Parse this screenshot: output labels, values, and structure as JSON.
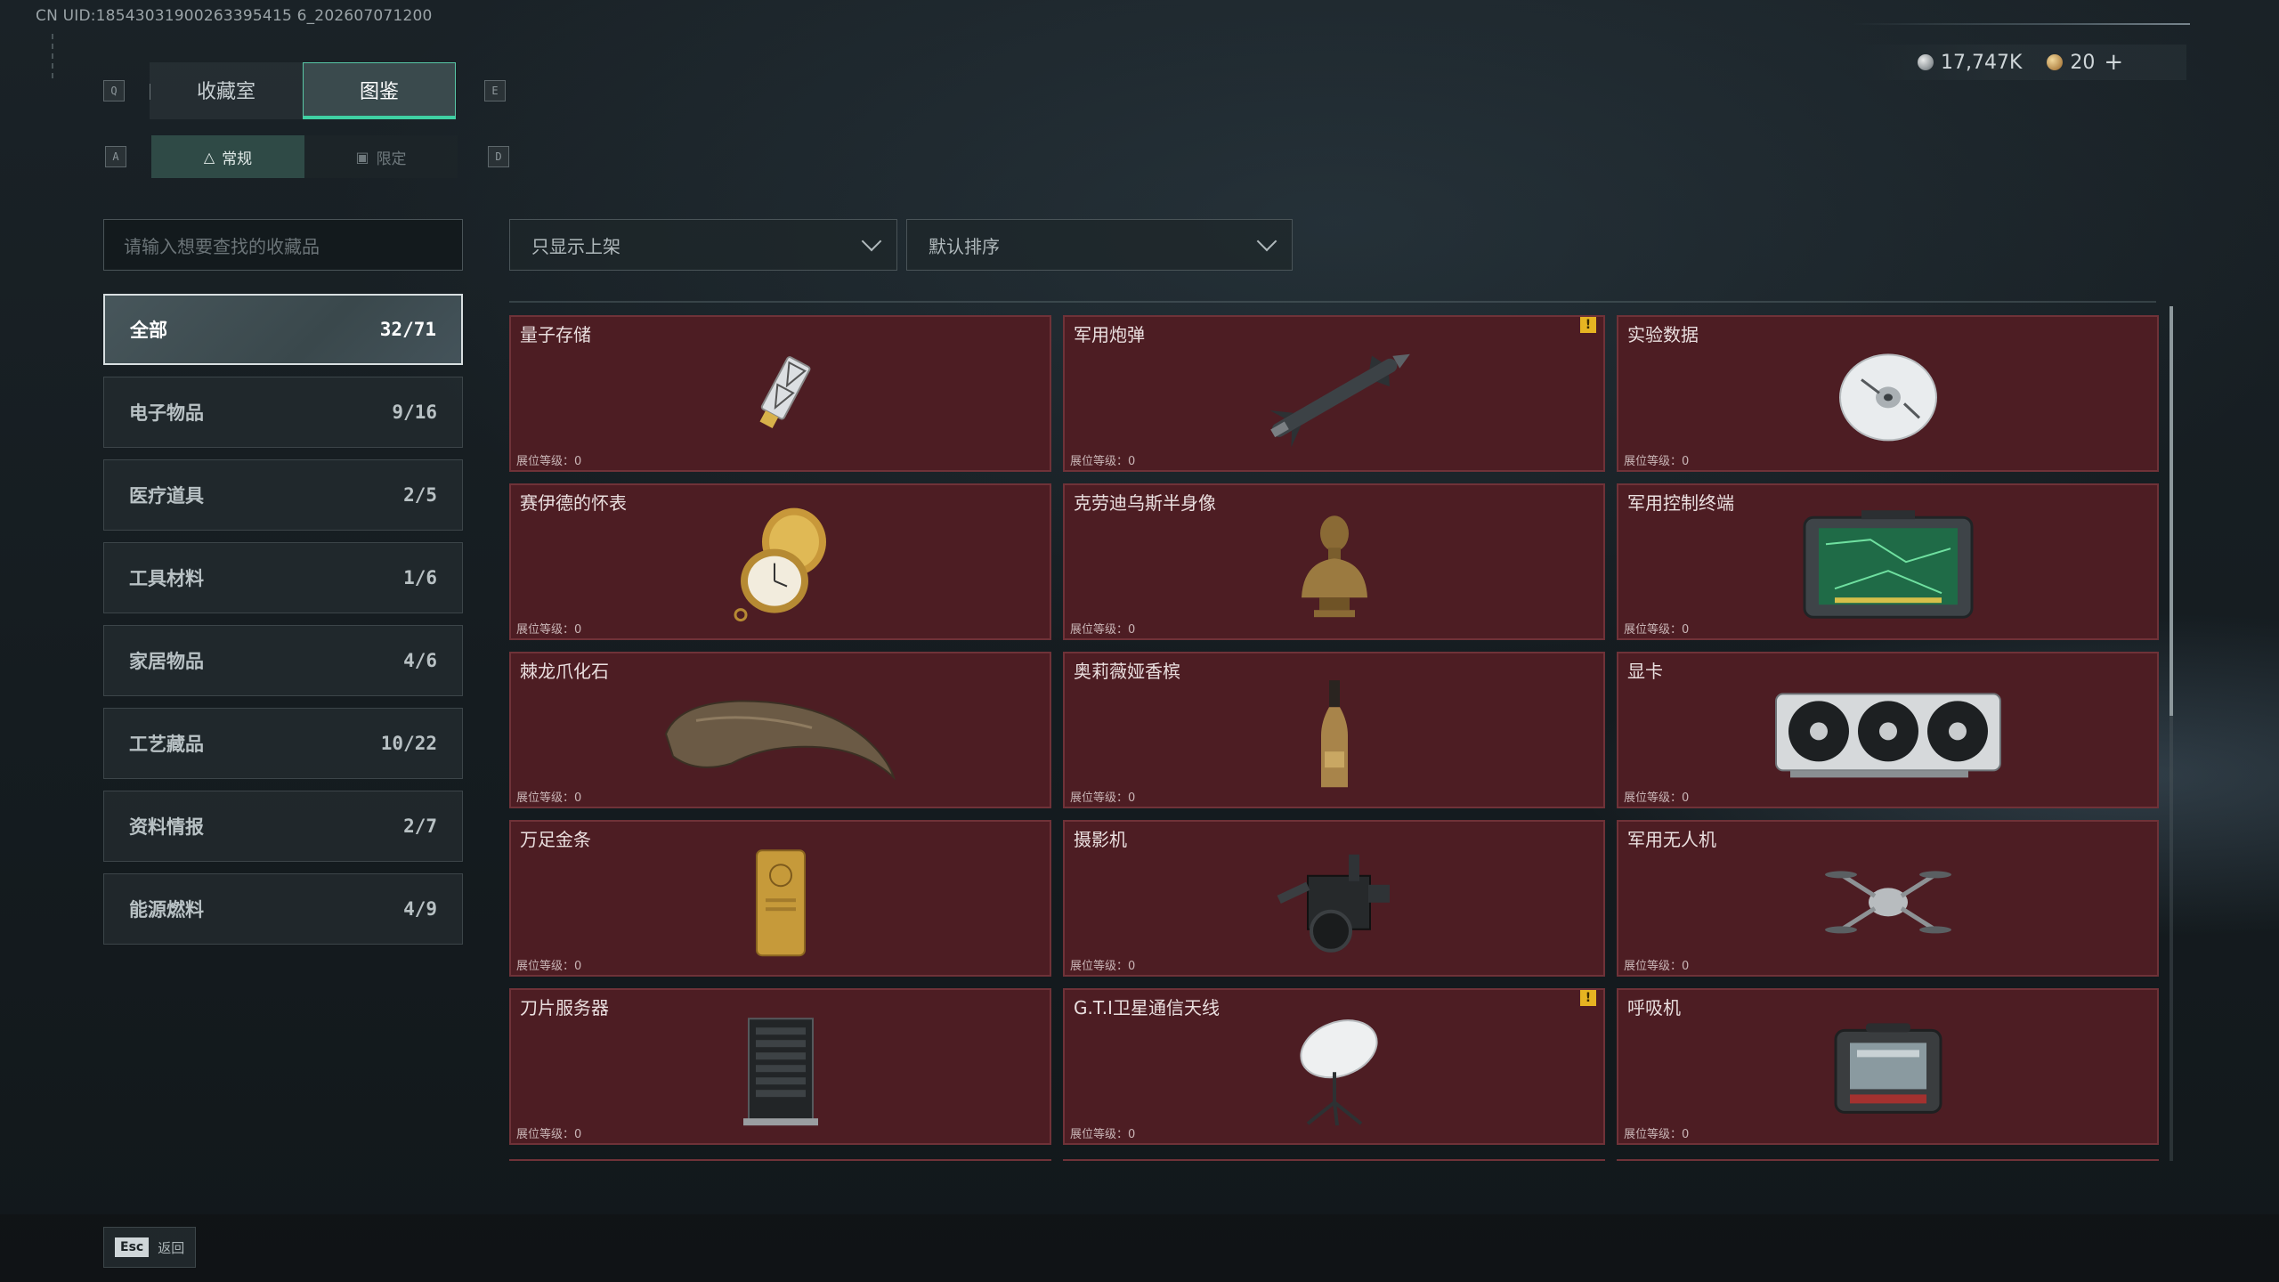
{
  "uid_text": "CN UID:18543031900263395415 6_202607071200",
  "currency": {
    "silver_amount": "17,747K",
    "gold_amount": "20",
    "add_label": "+"
  },
  "keys": {
    "prev_tab": "Q",
    "next_tab": "E",
    "prev_sub": "A",
    "next_sub": "D"
  },
  "tabs": [
    {
      "label": "收藏室",
      "active": false
    },
    {
      "label": "图鉴",
      "active": true
    }
  ],
  "subtabs": [
    {
      "label": "常规",
      "icon": "bottle-icon",
      "active": true
    },
    {
      "label": "限定",
      "icon": "limited-icon",
      "active": false
    }
  ],
  "search": {
    "placeholder": "请输入想要查找的收藏品"
  },
  "filters": {
    "shelf_filter": "只显示上架",
    "sort": "默认排序"
  },
  "categories": [
    {
      "label": "全部",
      "count": "32/71",
      "active": true
    },
    {
      "label": "电子物品",
      "count": "9/16"
    },
    {
      "label": "医疗道具",
      "count": "2/5"
    },
    {
      "label": "工具材料",
      "count": "1/6"
    },
    {
      "label": "家居物品",
      "count": "4/6"
    },
    {
      "label": "工艺藏品",
      "count": "10/22"
    },
    {
      "label": "资料情报",
      "count": "2/7"
    },
    {
      "label": "能源燃料",
      "count": "4/9"
    }
  ],
  "items": [
    {
      "name": "量子存储",
      "level": "展位等级：0",
      "icon": "usb-drive-icon",
      "warn": false
    },
    {
      "name": "军用炮弹",
      "level": "展位等级：0",
      "icon": "missile-icon",
      "warn": true
    },
    {
      "name": "实验数据",
      "level": "展位等级：0",
      "icon": "disc-icon",
      "warn": false
    },
    {
      "name": "赛伊德的怀表",
      "level": "展位等级：0",
      "icon": "pocket-watch-icon",
      "warn": false
    },
    {
      "name": "克劳迪乌斯半身像",
      "level": "展位等级：0",
      "icon": "bust-icon",
      "warn": false
    },
    {
      "name": "军用控制终端",
      "level": "展位等级：0",
      "icon": "tablet-terminal-icon",
      "warn": false
    },
    {
      "name": "棘龙爪化石",
      "level": "展位等级：0",
      "icon": "claw-fossil-icon",
      "warn": false
    },
    {
      "name": "奥莉薇娅香槟",
      "level": "展位等级：0",
      "icon": "champagne-icon",
      "warn": false
    },
    {
      "name": "显卡",
      "level": "展位等级：0",
      "icon": "gpu-icon",
      "warn": false
    },
    {
      "name": "万足金条",
      "level": "展位等级：0",
      "icon": "gold-bar-icon",
      "warn": false
    },
    {
      "name": "摄影机",
      "level": "展位等级：0",
      "icon": "camera-icon",
      "warn": false
    },
    {
      "name": "军用无人机",
      "level": "展位等级：0",
      "icon": "drone-icon",
      "warn": false
    },
    {
      "name": "刀片服务器",
      "level": "展位等级：0",
      "icon": "server-icon",
      "warn": false
    },
    {
      "name": "G.T.I卫星通信天线",
      "level": "展位等级：0",
      "icon": "satellite-dish-icon",
      "warn": true
    },
    {
      "name": "呼吸机",
      "level": "展位等级：0",
      "icon": "ventilator-icon",
      "warn": false
    }
  ],
  "footer": {
    "esc_key": "Esc",
    "back_label": "返回"
  },
  "colors": {
    "accent": "#3fd0a3",
    "card_bg": "#4d1d23",
    "warn": "#e6b422"
  }
}
